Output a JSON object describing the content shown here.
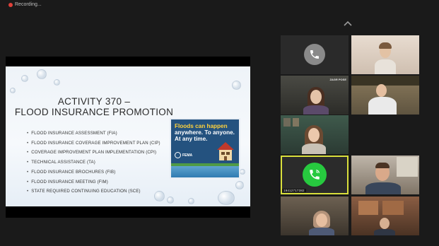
{
  "window": {
    "recording_label": "Recording..."
  },
  "slide": {
    "title_line1": "ACTIVITY 370 –",
    "title_line2": "FLOOD INSURANCE PROMOTION",
    "bullets": [
      "FLOOD INSURANCE ASSESSMENT (FIA)",
      "FLOOD INSURANCE COVERAGE IMPROVEMENT PLAN (CIP)",
      "COVERAGE IMPROVEMENT PLAN IMPLEMENTATION (CPI)",
      "TECHNICAL ASSISTANCE (TA)",
      "FLOOD INSURANCE BROCHURES (FIB)",
      "FLOOD INSURANCE MEETING (FIM)",
      "STATE REQUIRED CONTINUING EDUCATION (SCE)"
    ],
    "poster": {
      "line1": "Floods can happen",
      "line2": "anywhere. To anyone.",
      "line3": "At any time.",
      "org": "FEMA"
    }
  },
  "gallery": {
    "active_speaker_label": "19412717382",
    "woman2_sign": "ZAGR POSE"
  },
  "colors": {
    "active_border": "#d9df3c",
    "call_green": "#27c93f",
    "poster_blue": "#24527f",
    "poster_yellow": "#ffd23c"
  },
  "icons": [
    "record-dot-icon",
    "chevron-up-icon",
    "phone-icon",
    "house-icon",
    "fema-seal-icon"
  ]
}
